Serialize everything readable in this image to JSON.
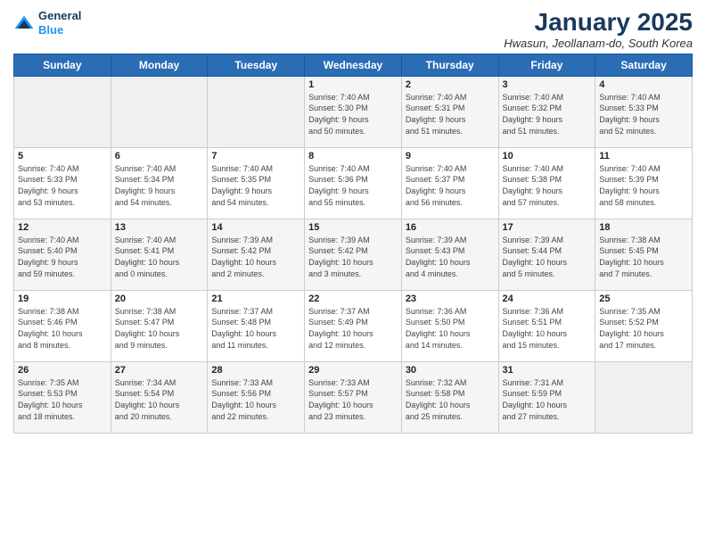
{
  "header": {
    "logo_line1": "General",
    "logo_line2": "Blue",
    "month_title": "January 2025",
    "subtitle": "Hwasun, Jeollanam-do, South Korea"
  },
  "days_of_week": [
    "Sunday",
    "Monday",
    "Tuesday",
    "Wednesday",
    "Thursday",
    "Friday",
    "Saturday"
  ],
  "weeks": [
    [
      {
        "day": "",
        "info": ""
      },
      {
        "day": "",
        "info": ""
      },
      {
        "day": "",
        "info": ""
      },
      {
        "day": "1",
        "info": "Sunrise: 7:40 AM\nSunset: 5:30 PM\nDaylight: 9 hours\nand 50 minutes."
      },
      {
        "day": "2",
        "info": "Sunrise: 7:40 AM\nSunset: 5:31 PM\nDaylight: 9 hours\nand 51 minutes."
      },
      {
        "day": "3",
        "info": "Sunrise: 7:40 AM\nSunset: 5:32 PM\nDaylight: 9 hours\nand 51 minutes."
      },
      {
        "day": "4",
        "info": "Sunrise: 7:40 AM\nSunset: 5:33 PM\nDaylight: 9 hours\nand 52 minutes."
      }
    ],
    [
      {
        "day": "5",
        "info": "Sunrise: 7:40 AM\nSunset: 5:33 PM\nDaylight: 9 hours\nand 53 minutes."
      },
      {
        "day": "6",
        "info": "Sunrise: 7:40 AM\nSunset: 5:34 PM\nDaylight: 9 hours\nand 54 minutes."
      },
      {
        "day": "7",
        "info": "Sunrise: 7:40 AM\nSunset: 5:35 PM\nDaylight: 9 hours\nand 54 minutes."
      },
      {
        "day": "8",
        "info": "Sunrise: 7:40 AM\nSunset: 5:36 PM\nDaylight: 9 hours\nand 55 minutes."
      },
      {
        "day": "9",
        "info": "Sunrise: 7:40 AM\nSunset: 5:37 PM\nDaylight: 9 hours\nand 56 minutes."
      },
      {
        "day": "10",
        "info": "Sunrise: 7:40 AM\nSunset: 5:38 PM\nDaylight: 9 hours\nand 57 minutes."
      },
      {
        "day": "11",
        "info": "Sunrise: 7:40 AM\nSunset: 5:39 PM\nDaylight: 9 hours\nand 58 minutes."
      }
    ],
    [
      {
        "day": "12",
        "info": "Sunrise: 7:40 AM\nSunset: 5:40 PM\nDaylight: 9 hours\nand 59 minutes."
      },
      {
        "day": "13",
        "info": "Sunrise: 7:40 AM\nSunset: 5:41 PM\nDaylight: 10 hours\nand 0 minutes."
      },
      {
        "day": "14",
        "info": "Sunrise: 7:39 AM\nSunset: 5:42 PM\nDaylight: 10 hours\nand 2 minutes."
      },
      {
        "day": "15",
        "info": "Sunrise: 7:39 AM\nSunset: 5:42 PM\nDaylight: 10 hours\nand 3 minutes."
      },
      {
        "day": "16",
        "info": "Sunrise: 7:39 AM\nSunset: 5:43 PM\nDaylight: 10 hours\nand 4 minutes."
      },
      {
        "day": "17",
        "info": "Sunrise: 7:39 AM\nSunset: 5:44 PM\nDaylight: 10 hours\nand 5 minutes."
      },
      {
        "day": "18",
        "info": "Sunrise: 7:38 AM\nSunset: 5:45 PM\nDaylight: 10 hours\nand 7 minutes."
      }
    ],
    [
      {
        "day": "19",
        "info": "Sunrise: 7:38 AM\nSunset: 5:46 PM\nDaylight: 10 hours\nand 8 minutes."
      },
      {
        "day": "20",
        "info": "Sunrise: 7:38 AM\nSunset: 5:47 PM\nDaylight: 10 hours\nand 9 minutes."
      },
      {
        "day": "21",
        "info": "Sunrise: 7:37 AM\nSunset: 5:48 PM\nDaylight: 10 hours\nand 11 minutes."
      },
      {
        "day": "22",
        "info": "Sunrise: 7:37 AM\nSunset: 5:49 PM\nDaylight: 10 hours\nand 12 minutes."
      },
      {
        "day": "23",
        "info": "Sunrise: 7:36 AM\nSunset: 5:50 PM\nDaylight: 10 hours\nand 14 minutes."
      },
      {
        "day": "24",
        "info": "Sunrise: 7:36 AM\nSunset: 5:51 PM\nDaylight: 10 hours\nand 15 minutes."
      },
      {
        "day": "25",
        "info": "Sunrise: 7:35 AM\nSunset: 5:52 PM\nDaylight: 10 hours\nand 17 minutes."
      }
    ],
    [
      {
        "day": "26",
        "info": "Sunrise: 7:35 AM\nSunset: 5:53 PM\nDaylight: 10 hours\nand 18 minutes."
      },
      {
        "day": "27",
        "info": "Sunrise: 7:34 AM\nSunset: 5:54 PM\nDaylight: 10 hours\nand 20 minutes."
      },
      {
        "day": "28",
        "info": "Sunrise: 7:33 AM\nSunset: 5:56 PM\nDaylight: 10 hours\nand 22 minutes."
      },
      {
        "day": "29",
        "info": "Sunrise: 7:33 AM\nSunset: 5:57 PM\nDaylight: 10 hours\nand 23 minutes."
      },
      {
        "day": "30",
        "info": "Sunrise: 7:32 AM\nSunset: 5:58 PM\nDaylight: 10 hours\nand 25 minutes."
      },
      {
        "day": "31",
        "info": "Sunrise: 7:31 AM\nSunset: 5:59 PM\nDaylight: 10 hours\nand 27 minutes."
      },
      {
        "day": "",
        "info": ""
      }
    ]
  ]
}
